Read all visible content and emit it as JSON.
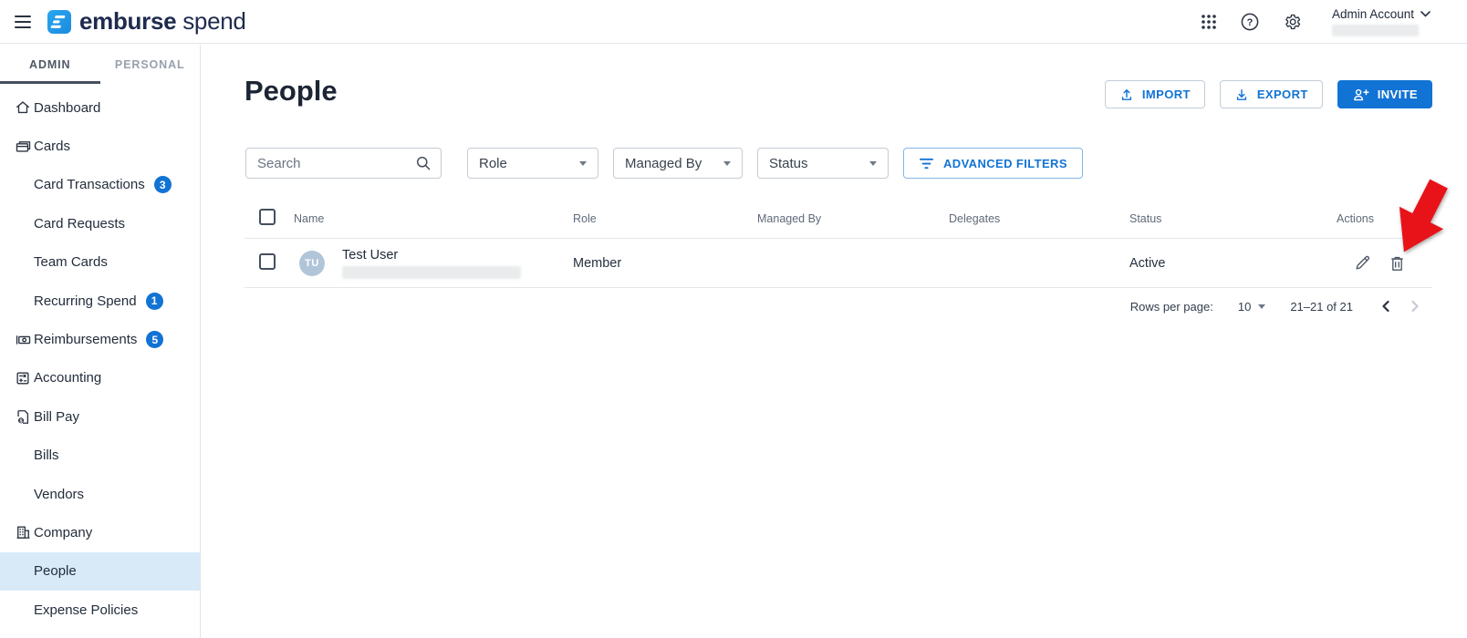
{
  "colors": {
    "accent_blue": "#1173d4",
    "brand_navy": "#1e2b4e",
    "logo_blue": "#1f9ce8",
    "active_nav_bg": "#d8eaf8",
    "avatar_bg": "#b1c5d9",
    "annotation_red": "#e81219",
    "badge_bg": "#1173d4"
  },
  "topbar": {
    "logo_primary": "emburse",
    "logo_secondary": "spend",
    "help_glyph": "?",
    "account_label": "Admin Account",
    "account_value_redacted": true
  },
  "sidebar": {
    "tabs": [
      {
        "label": "ADMIN",
        "active": true
      },
      {
        "label": "PERSONAL",
        "active": false
      }
    ],
    "items": [
      {
        "label": "Dashboard",
        "icon": "home",
        "level": 1
      },
      {
        "label": "Cards",
        "icon": "cards",
        "level": 1
      },
      {
        "label": "Card Transactions",
        "level": 2,
        "badge": "3"
      },
      {
        "label": "Card Requests",
        "level": 2
      },
      {
        "label": "Team Cards",
        "level": 2
      },
      {
        "label": "Recurring Spend",
        "level": 2,
        "badge": "1"
      },
      {
        "label": "Reimbursements",
        "icon": "cash",
        "level": 1,
        "badge": "5"
      },
      {
        "label": "Accounting",
        "icon": "calculator",
        "level": 1
      },
      {
        "label": "Bill Pay",
        "icon": "bill",
        "level": 1
      },
      {
        "label": "Bills",
        "level": 2
      },
      {
        "label": "Vendors",
        "level": 2
      },
      {
        "label": "Company",
        "icon": "building",
        "level": 1
      },
      {
        "label": "People",
        "level": 2,
        "active": true
      },
      {
        "label": "Expense Policies",
        "level": 2
      }
    ]
  },
  "page": {
    "title": "People",
    "buttons": {
      "import": "IMPORT",
      "export": "EXPORT",
      "invite": "INVITE"
    }
  },
  "filters": {
    "search_placeholder": "Search",
    "role": "Role",
    "managed_by": "Managed By",
    "status": "Status",
    "advanced": "ADVANCED FILTERS"
  },
  "table": {
    "columns": [
      "Name",
      "Role",
      "Managed By",
      "Delegates",
      "Status",
      "Actions"
    ],
    "rows": [
      {
        "initials": "TU",
        "name": "Test User",
        "email_redacted": true,
        "role": "Member",
        "managed_by": "",
        "delegates": "",
        "status": "Active"
      }
    ]
  },
  "pagination": {
    "rows_per_page_label": "Rows per page:",
    "rows_per_page_value": "10",
    "range": "21–21 of 21"
  },
  "annotation": {
    "type": "red-arrow",
    "points_at": "delete-trash-icon"
  }
}
